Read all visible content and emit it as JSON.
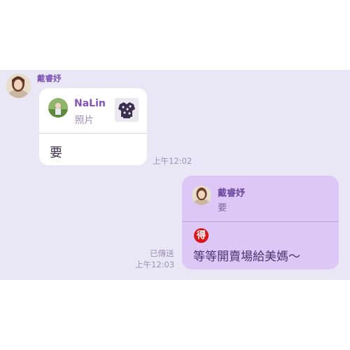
{
  "chat": {
    "incoming": {
      "sender_name": "戴睿妤",
      "reply_to": {
        "name": "NaLin",
        "content_type": "照片"
      },
      "message": "要",
      "time": "上午12:02"
    },
    "outgoing": {
      "reply_to": {
        "name": "戴睿妤",
        "content": "要"
      },
      "badge_glyph": "得",
      "message": "等等開賣場給美媽～",
      "status": "已傳送",
      "time": "上午12:03"
    }
  },
  "colors": {
    "chat_background": "#e9e6f6",
    "incoming_bubble": "#ffffff",
    "outgoing_bubble": "#dcc7f7",
    "accent_name": "#8454b8",
    "timestamp": "#9b93b3"
  }
}
